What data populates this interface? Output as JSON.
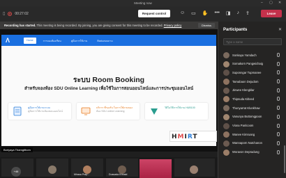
{
  "window": {
    "title": "Meeting now",
    "minimize": "–",
    "maximize": "▢",
    "close": "✕"
  },
  "toolbar": {
    "timer": "00:27:02",
    "request_control": "Request control",
    "leave": "Leave",
    "icons": [
      "people-icon",
      "chat-icon",
      "raise-hand-icon",
      "more-icon",
      "camera-icon",
      "mic-icon",
      "share-icon"
    ]
  },
  "banner": {
    "bold": "Recording has started.",
    "text": " This meeting is being recorded. By joining, you are giving consent for this meeting to be recorded. ",
    "link": "Privacy policy",
    "dismiss": "Dismiss"
  },
  "site": {
    "logo": "Λ",
    "nav": [
      "Home",
      "การจองห้องเรียน",
      "คู่มือการใช้งาน",
      "ติดต่อสอบถาม"
    ],
    "title": "ระบบ Room Booking",
    "subtitle": "สำหรับจองห้อง SDU Online Learning เพื่อใช้ในการสอนออนไลน์และการประชุมออนไลน์",
    "cards": [
      {
        "t1": "คู่มือการใช้งานระบบ",
        "t2": "คู่มือการใช้งานห้องสอนออนไลน์"
      },
      {
        "t1": "บริการ ที่รองรับ ในการใช้งานของ",
        "t2": "ห้อง SDU online Learning"
      },
      {
        "t1": "วิดีโอวิธีการใช้งาน HUB100",
        "t2": ""
      }
    ],
    "brand": {
      "h": "H",
      "m": "M",
      "i": "I",
      "r": "R",
      "tail": "T"
    }
  },
  "stage": {
    "speaker": "Boriyaya Thamgithom"
  },
  "gallery": {
    "more": "+46",
    "names": [
      "",
      "Mirasa Prap...",
      "Dussada Khhaid",
      "",
      ""
    ]
  },
  "panel": {
    "title": "Participants",
    "close": "✕",
    "search_placeholder": "Type a name",
    "participants": [
      "Sonkaya Yamdach",
      "Somakorn Pangwichaig",
      "Suponngar Tupmanee",
      "Tamabaon Dejudom",
      "Jinwee Klengklar",
      "Thipsuda Kitleed",
      "Thunyarrat Klunkhaw",
      "Vanunya Buttomgpoon",
      "Viona Panlcoom",
      "Wanee Kimruang",
      "Wannaporn Nutchanon",
      "Woravon Depradung"
    ]
  },
  "colors": {
    "accent": "#1a6fe0",
    "leave": "#c4314b",
    "recording": "#e04b4b"
  }
}
